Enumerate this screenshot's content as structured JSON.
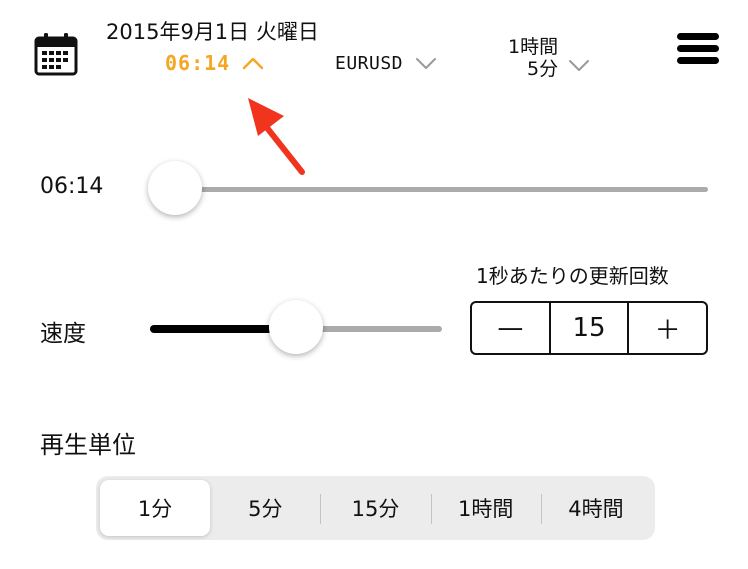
{
  "header": {
    "calendar_icon": "calendar-icon",
    "date": "2015年9月1日 火曜日",
    "time": "06:14",
    "time_chevron": "chevron-up-icon",
    "pair": "EURUSD",
    "pair_chevron": "chevron-down-icon",
    "timeframe_line1": "1時間",
    "timeframe_line2": "5分",
    "timeframe_chevron": "chevron-down-icon",
    "menu_icon": "hamburger-menu-icon",
    "accent_color": "#F5A623"
  },
  "annotation": {
    "icon": "red-arrow-icon",
    "color": "#F0341E"
  },
  "time_slider": {
    "label": "06:14",
    "value": 0.0
  },
  "speed": {
    "label": "速度",
    "slider_value": 0.5,
    "rate_label": "1秒あたりの更新回数",
    "minus_label": "—",
    "value": "15",
    "plus_label": "＋"
  },
  "playback_unit": {
    "label": "再生単位",
    "options": [
      "1分",
      "5分",
      "15分",
      "1時間",
      "4時間"
    ],
    "selected_index": 0
  }
}
